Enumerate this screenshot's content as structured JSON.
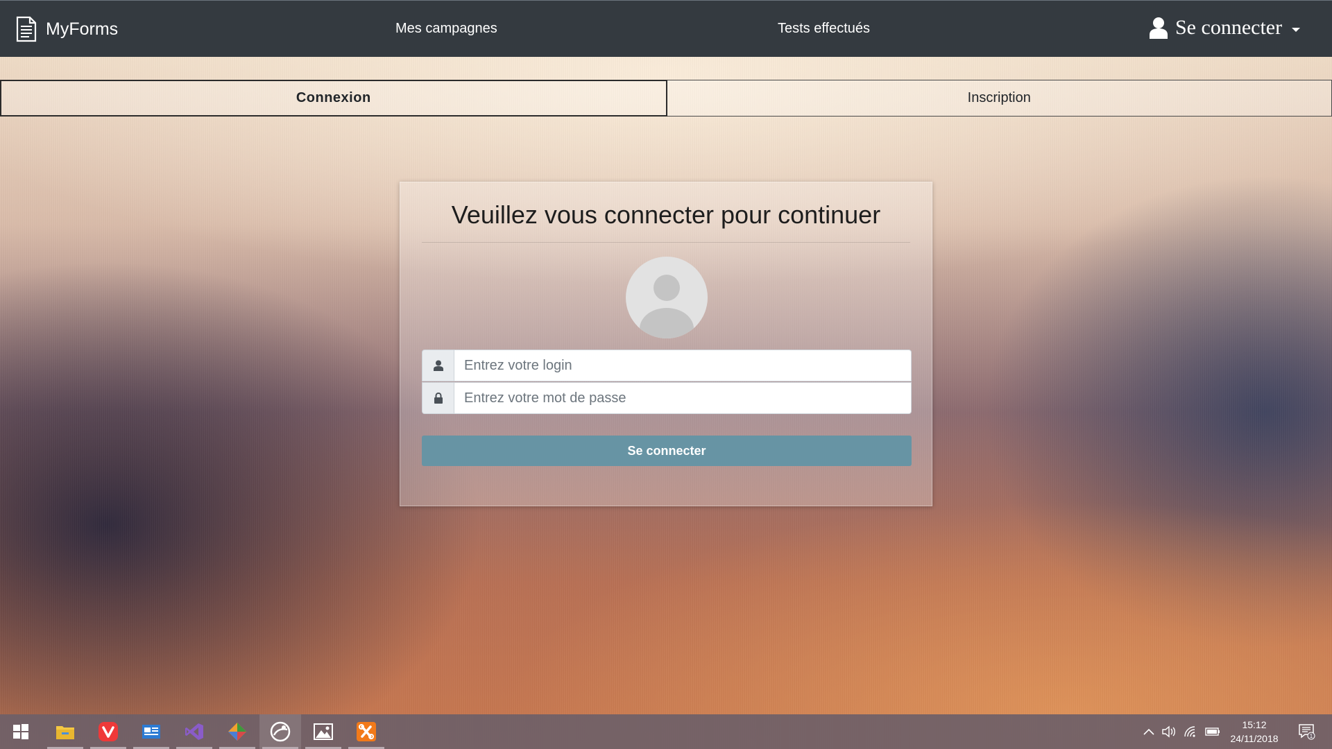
{
  "navbar": {
    "brand": "MyForms",
    "links": [
      "Mes campagnes",
      "Tests effectués"
    ],
    "login_menu_label": "Se connecter"
  },
  "tabs": {
    "login": "Connexion",
    "signup": "Inscription"
  },
  "card": {
    "title": "Veuillez vous connecter pour continuer",
    "login_placeholder": "Entrez votre login",
    "password_placeholder": "Entrez votre mot de passe",
    "submit_label": "Se connecter"
  },
  "taskbar": {
    "apps": [
      "windows-start-icon",
      "file-explorer-icon",
      "vivaldi-icon",
      "email-app-icon",
      "visual-studio-icon",
      "git-icon",
      "eclipse-icon",
      "photos-icon",
      "xampp-icon"
    ],
    "time": "15:12",
    "date": "24/11/2018",
    "notification_count": "1"
  },
  "colors": {
    "navbar": "#343a40",
    "button": "#6794a4"
  }
}
